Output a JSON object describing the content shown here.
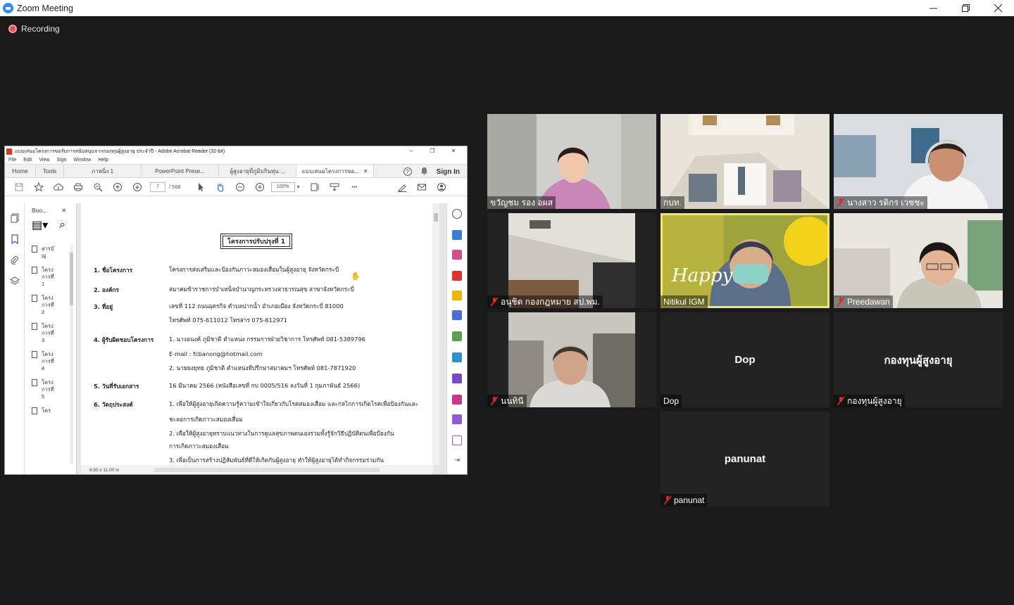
{
  "window": {
    "title": "Zoom Meeting"
  },
  "recording": {
    "label": "Recording"
  },
  "acrobat": {
    "title": "แบบเสนอโครงการขอรับการสนับสนุนจากกองทุนผู้สูงอายุ ประจำปี - Adobe Acrobat Reader (32-bit)",
    "menu": [
      "File",
      "Edit",
      "View",
      "Sign",
      "Window",
      "Help"
    ],
    "tabs": {
      "home": "Home",
      "tools": "Tools",
      "doc1": "ภาพนิ่ง 1",
      "doc2": "PowerPoint Prese...",
      "doc3": "ผู้สูงอายุที่ภูมิบกินหุ่น ...",
      "doc4": "แบบเสนอโครงการขอ..."
    },
    "sign_in": "Sign In",
    "page_current": "7",
    "page_total": "/ 568",
    "zoom": "100%",
    "bookmarks_title": "Boo...",
    "bookmarks": [
      "สารบัญ",
      "โครงการที่ 1",
      "โครงการที่ 2",
      "โครงการที่ 3",
      "โครงการที่ 4",
      "โครงการที่ 5",
      "โคร"
    ],
    "page_size": "8.50 x 11.00 in"
  },
  "document": {
    "heading": "โครงการปรับปรุงที่  1",
    "rows": [
      {
        "label": "1. ชื่อโครงการ",
        "value": "โครงการส่งเสริมและป้องกันภาวะสมองเสื่อมในผู้สูงอายุ จังหวัดกระบี่"
      },
      {
        "label": "2. องค์กร",
        "value": "สมาคมข้าราชการบำเหน็จบำนาญกระทรวงสาธารณสุข สาขาจังหวัดกระบี่"
      },
      {
        "label": "3. ที่อยู่",
        "value": "เลขที่ 112 ถนนอุตรกิจ ตำบลปากน้ำ อำเภอเมือง จังหวัดกระบี่ 81000"
      },
      {
        "label": "",
        "value": "โทรศัพท์ 075-611012  โทรสาร 075-612971"
      },
      {
        "label": "4. ผู้รับผิดชอบโครงการ",
        "value": "1. นางอนงค์  ภูมิชาติ ตำแหน่ง กรรมการฝ่ายวิชาการ โทรศัพท์ 081-5389796"
      },
      {
        "label": "",
        "value": "E-mail : fcbanong@hotmail.com"
      },
      {
        "label": "",
        "value": "2. นายยงยุทธ  ภูมิชาติ ตำแหน่งที่ปรึกษาสมาคมฯ โทรศัพท์ 081-7871920"
      },
      {
        "label": "5. วันที่รับเอกสาร",
        "value": "16 มีนาคม 2566 (หนังสือเลขที่ กบ 0005/516 ลงวันที่ 1 กุมภาพันธ์ 2566)"
      },
      {
        "label": "6. วัตถุประสงค์",
        "value": "1. เพื่อให้ผู้สูงอายุเกิดความรู้ความเข้าใจเกี่ยวกับโรคสมองเสื่อม และกลไกการเกิดโรคเพื่อป้องกันและ"
      },
      {
        "label": "",
        "value": "ชะลอการเกิดภาวะสมองเสื่อม"
      },
      {
        "label": "",
        "value": "2. เพื่อให้ผู้สูงอายุทราบแนวทางในการดูแลสุขภาพตนเองรวมทั้งรู้จักวิธีปฏิบัติตนเพื่อป้องกัน"
      },
      {
        "label": "",
        "value": "การเกิดภาวะสมองเสื่อม"
      },
      {
        "label": "",
        "value": "3. เพื่อเป็นการสร้างปฏิสัมพันธ์ที่ดีให้เกิดกับผู้สูงอายุ ทำให้ผู้สูงอายุได้ทำกิจกรรมร่วมกัน"
      }
    ]
  },
  "participants": [
    {
      "name": "ขวัญชม  รอง อผส",
      "muted": false,
      "video": true
    },
    {
      "name": "กบท.",
      "muted": false,
      "video": true
    },
    {
      "name": "นางสาว รติกร เวชชะ",
      "muted": true,
      "video": true
    },
    {
      "name": "อนุชิต กองกฎหมาย สป.พม.",
      "muted": true,
      "video": true
    },
    {
      "name": "Nitikul IGM",
      "muted": false,
      "video": true,
      "speaking": true
    },
    {
      "name": "Preedawan",
      "muted": true,
      "video": true
    },
    {
      "name": "นนทินี",
      "muted": true,
      "video": true
    },
    {
      "name": "Dop",
      "muted": false,
      "video": false,
      "display": "Dop"
    },
    {
      "name": "กองทุนผู้สูงอายุ",
      "muted": true,
      "video": false,
      "display": "กองทุนผู้สูงอายุ"
    },
    {
      "name": "panunat",
      "muted": true,
      "video": false,
      "display": "panunat"
    }
  ],
  "video_overlays": {
    "happy_text": "Happy"
  },
  "colors": {
    "zoom_blue": "#2d8cff",
    "muted_red": "#e02828",
    "speaker_outline": "#f2e76a",
    "meeting_bg": "#1a1a1a"
  }
}
